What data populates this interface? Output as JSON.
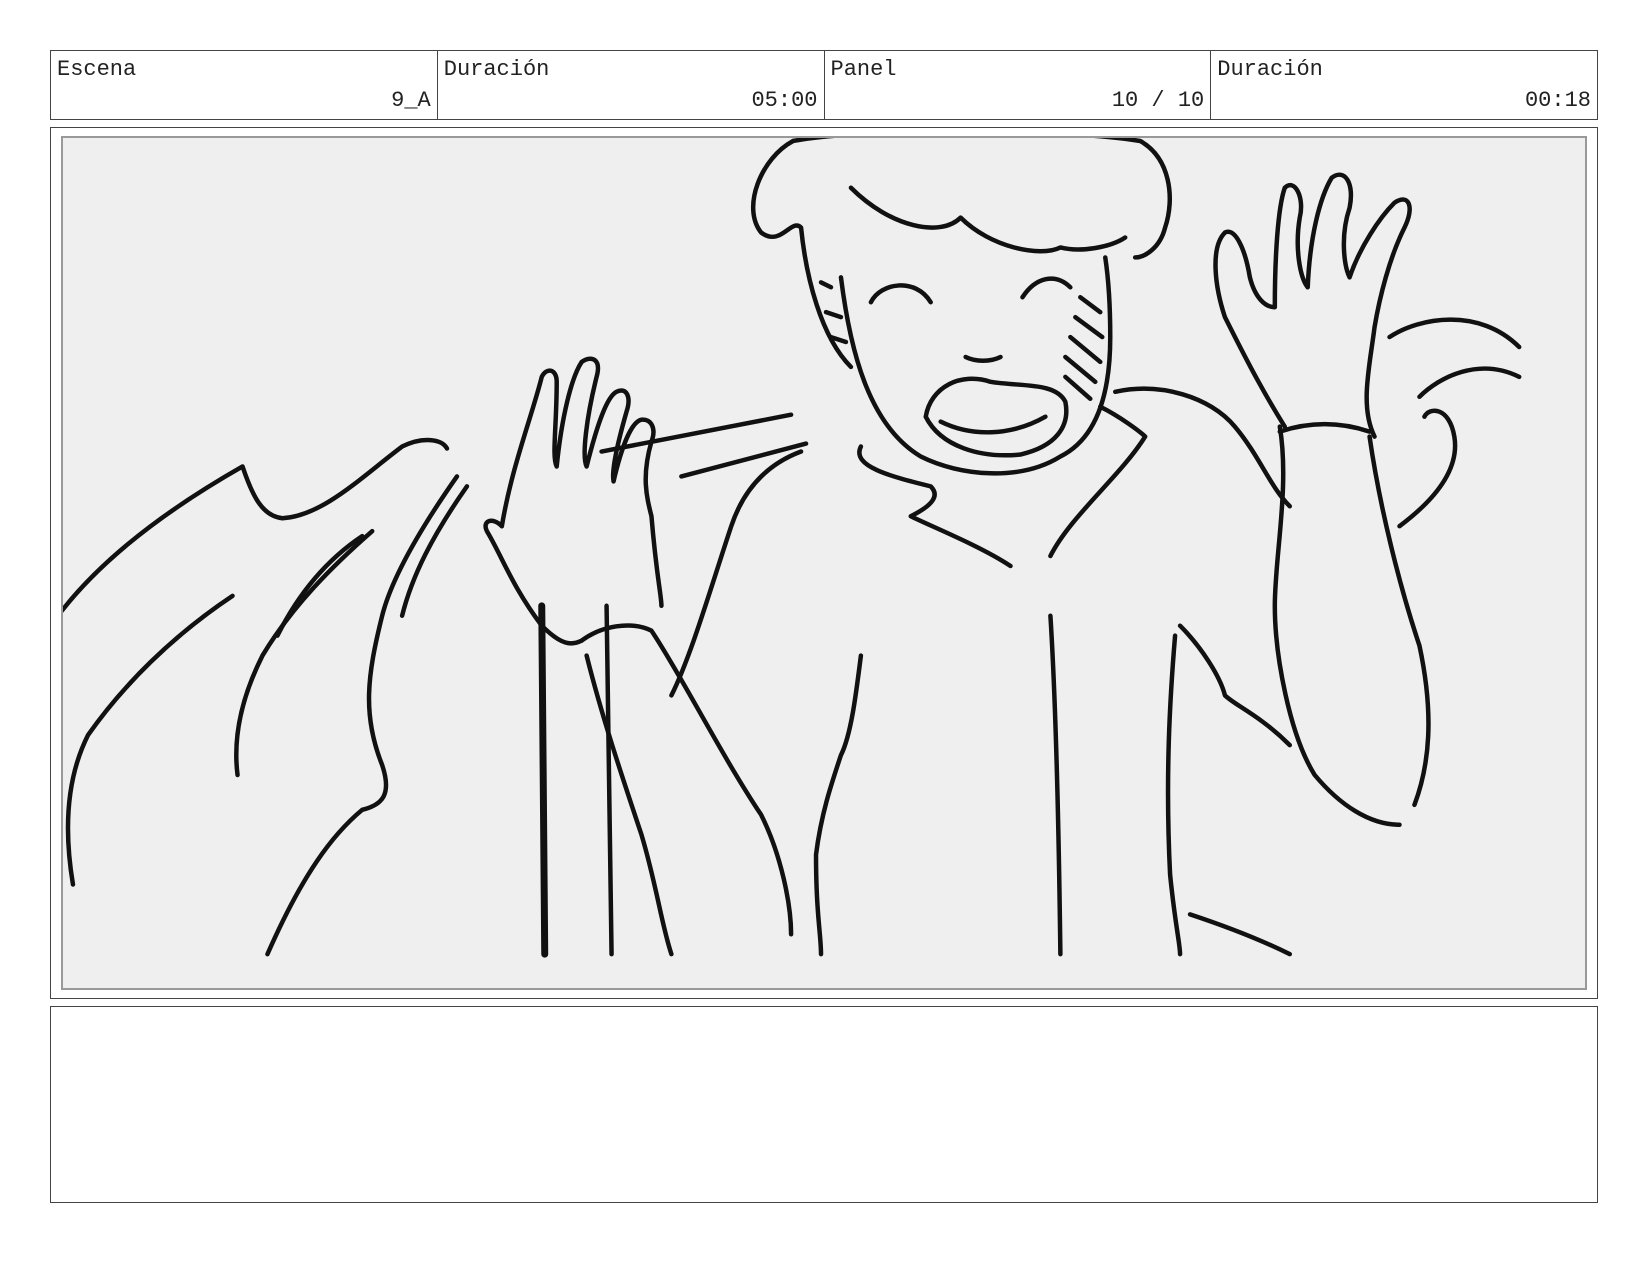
{
  "header": {
    "scene_label": "Escena",
    "scene_value": "9_A",
    "duration_label": "Duración",
    "duration_value": "05:00",
    "panel_label": "Panel",
    "panel_value": "10 / 10",
    "panel_duration_label": "Duración",
    "panel_duration_value": "00:18"
  },
  "notes": {
    "text": ""
  }
}
